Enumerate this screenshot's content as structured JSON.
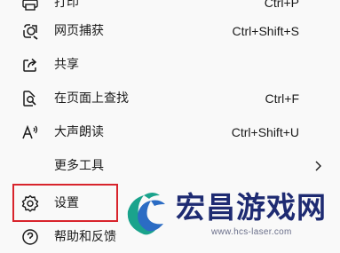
{
  "menu": {
    "items": [
      {
        "label": "打印",
        "shortcut": "Ctrl+P",
        "icon": "printer-icon"
      },
      {
        "label": "网页捕获",
        "shortcut": "Ctrl+Shift+S",
        "icon": "web-capture-icon"
      },
      {
        "label": "共享",
        "shortcut": "",
        "icon": "share-icon"
      },
      {
        "label": "在页面上查找",
        "shortcut": "Ctrl+F",
        "icon": "find-on-page-icon"
      },
      {
        "label": "大声朗读",
        "shortcut": "Ctrl+Shift+U",
        "icon": "read-aloud-icon"
      },
      {
        "label": "更多工具",
        "shortcut": "",
        "icon": "chevron-right-icon"
      },
      {
        "label": "设置",
        "shortcut": "",
        "icon": "gear-icon"
      },
      {
        "label": "帮助和反馈",
        "shortcut": "",
        "icon": "help-icon"
      }
    ]
  },
  "highlight_color": "#d8242c",
  "watermark": {
    "title": "宏昌游戏网",
    "url": "www.hcs-laser.com",
    "title_color": "#1e2b72",
    "logo_colors": [
      "#1aa38c",
      "#2b6cc4"
    ]
  }
}
